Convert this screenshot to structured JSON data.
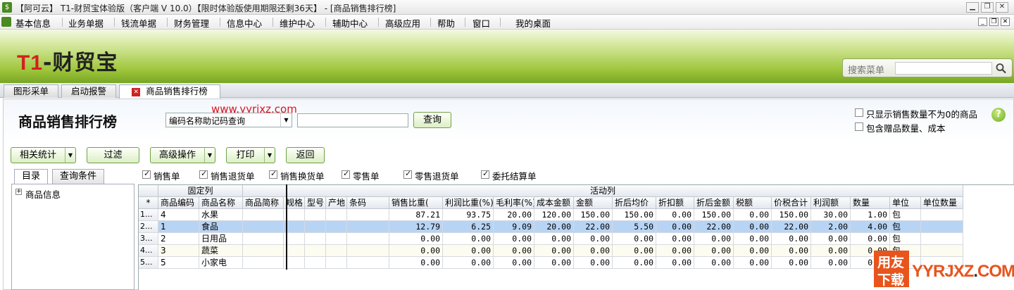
{
  "window": {
    "title": "【阿可云】 T1-财贸宝体验版（客户端 V 10.0）【限时体验版使用期限还剩36天】 - [商品销售排行榜]",
    "app_icon": "money-bag-icon"
  },
  "menu": [
    "基本信息",
    "业务单据",
    "钱流单据",
    "财务管理",
    "信息中心",
    "维护中心",
    "辅助中心",
    "高级应用",
    "帮助",
    "窗口",
    "我的桌面"
  ],
  "banner": {
    "logo_prefix": "T1",
    "logo_suffix": "-财贸宝",
    "search_label": "搜索菜单",
    "search_value": ""
  },
  "tabs": [
    {
      "label": "图形采单"
    },
    {
      "label": "启动报警"
    },
    {
      "label": "商品销售排行榜",
      "active": true
    }
  ],
  "page": {
    "title": "商品销售排行榜",
    "watermark": "www.yyrjxz.com",
    "query_mode": "编码名称助记码查询",
    "query_input": "",
    "query_button": "查询",
    "option1": "只显示销售数量不为0的商品",
    "option2": "包含赠品数量、成本"
  },
  "toolbar": {
    "related_stats": "相关统计",
    "filter": "过滤",
    "advanced": "高级操作",
    "print": "打印",
    "back": "返回"
  },
  "left_tabs": [
    "目录",
    "查询条件"
  ],
  "tree": {
    "root": "商品信息"
  },
  "doc_types": [
    {
      "label": "销售单",
      "checked": true
    },
    {
      "label": "销售退货单",
      "checked": true
    },
    {
      "label": "销售换货单",
      "checked": true
    },
    {
      "label": "零售单",
      "checked": true
    },
    {
      "label": "零售退货单",
      "checked": true
    },
    {
      "label": "委托结算单",
      "checked": true
    }
  ],
  "grid": {
    "group_fixed": "固定列",
    "group_active": "活动列",
    "star": "*",
    "columns": [
      "商品编码",
      "商品名称",
      "商品简称",
      "规格",
      "型号",
      "产地",
      "条码",
      "销售比重(",
      "利润比重(%)",
      "毛利率(%)",
      "成本金额",
      "金额",
      "折后均价",
      "折扣额",
      "折后金额",
      "税额",
      "价税合计",
      "利润额",
      "数量",
      "单位",
      "单位数量"
    ],
    "sort_icon": "sort-desc-icon",
    "rows": [
      {
        "rn": "1...",
        "code": "4",
        "name": "水果",
        "abbr": "",
        "spec": "",
        "model": "",
        "origin": "",
        "barcode": "",
        "sales_pct": "87.21",
        "profit_pct": "93.75",
        "margin": "20.00",
        "cost": "120.00",
        "amount": "150.00",
        "avg_price": "150.00",
        "discount": "0.00",
        "net_amount": "150.00",
        "tax": "0.00",
        "total": "150.00",
        "profit": "30.00",
        "qty": "1.00",
        "unit": "包",
        "unit_qty": ""
      },
      {
        "rn": "2...",
        "code": "1",
        "name": "食品",
        "abbr": "",
        "spec": "",
        "model": "",
        "origin": "",
        "barcode": "",
        "sales_pct": "12.79",
        "profit_pct": "6.25",
        "margin": "9.09",
        "cost": "20.00",
        "amount": "22.00",
        "avg_price": "5.50",
        "discount": "0.00",
        "net_amount": "22.00",
        "tax": "0.00",
        "total": "22.00",
        "profit": "2.00",
        "qty": "4.00",
        "unit": "包",
        "unit_qty": "",
        "selected": true
      },
      {
        "rn": "3...",
        "code": "2",
        "name": "日用品",
        "abbr": "",
        "spec": "",
        "model": "",
        "origin": "",
        "barcode": "",
        "sales_pct": "0.00",
        "profit_pct": "0.00",
        "margin": "0.00",
        "cost": "0.00",
        "amount": "0.00",
        "avg_price": "0.00",
        "discount": "0.00",
        "net_amount": "0.00",
        "tax": "0.00",
        "total": "0.00",
        "profit": "0.00",
        "qty": "0.00",
        "unit": "包",
        "unit_qty": ""
      },
      {
        "rn": "4...",
        "code": "3",
        "name": "蔬菜",
        "abbr": "",
        "spec": "",
        "model": "",
        "origin": "",
        "barcode": "",
        "sales_pct": "0.00",
        "profit_pct": "0.00",
        "margin": "0.00",
        "cost": "0.00",
        "amount": "0.00",
        "avg_price": "0.00",
        "discount": "0.00",
        "net_amount": "0.00",
        "tax": "0.00",
        "total": "0.00",
        "profit": "0.00",
        "qty": "0.00",
        "unit": "包",
        "unit_qty": ""
      },
      {
        "rn": "5...",
        "code": "5",
        "name": "小家电",
        "abbr": "",
        "spec": "",
        "model": "",
        "origin": "",
        "barcode": "",
        "sales_pct": "0.00",
        "profit_pct": "0.00",
        "margin": "0.00",
        "cost": "0.00",
        "amount": "0.00",
        "avg_price": "0.00",
        "discount": "0.00",
        "net_amount": "0.00",
        "tax": "0.00",
        "total": "0.00",
        "profit": "0.00",
        "qty": "0.00",
        "unit": "包",
        "unit_qty": ""
      }
    ]
  },
  "brand": {
    "line1": "用友",
    "line2": "下载",
    "text": "YYRJXZ",
    "dot": ".",
    "tld": "COM"
  },
  "colors": {
    "banner_green": "#9fc63c",
    "selected_row": "#b8d4f4",
    "watermark_red": "#e0101e",
    "brand_orange": "#e8541c"
  }
}
